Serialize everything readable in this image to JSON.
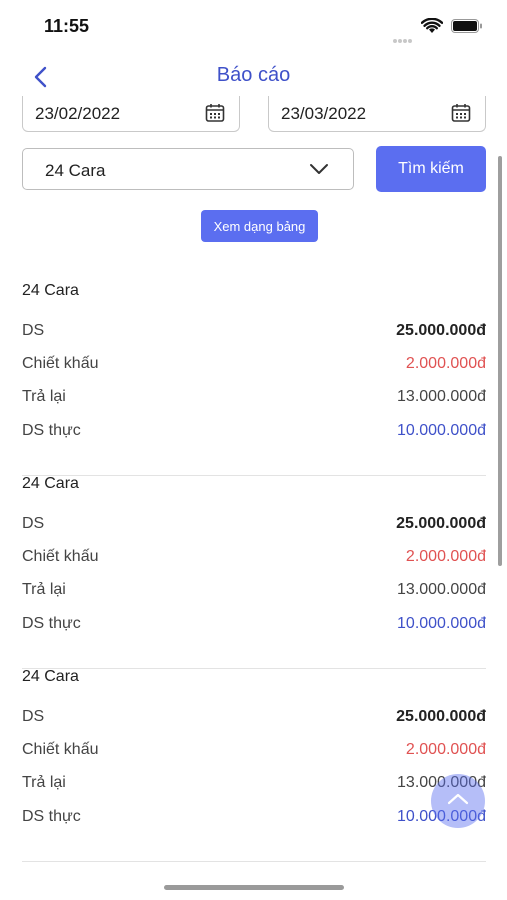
{
  "status_bar": {
    "time": "11:55"
  },
  "header": {
    "title": "Báo cáo"
  },
  "filters": {
    "date_from": "23/02/2022",
    "date_to": "23/03/2022",
    "selected_store": "24 Cara",
    "search_label": "Tìm kiếm",
    "table_view_label": "Xem dạng bảng"
  },
  "reports": [
    {
      "name": "24 Cara",
      "rows": [
        {
          "label": "DS",
          "value": "25.000.000đ"
        },
        {
          "label": "Chiết khấu",
          "value": "2.000.000đ"
        },
        {
          "label": "Trả lại",
          "value": "13.000.000đ"
        },
        {
          "label": "DS thực",
          "value": "10.000.000đ"
        }
      ]
    },
    {
      "name": "24 Cara",
      "rows": [
        {
          "label": "DS",
          "value": "25.000.000đ"
        },
        {
          "label": "Chiết khấu",
          "value": "2.000.000đ"
        },
        {
          "label": "Trả lại",
          "value": "13.000.000đ"
        },
        {
          "label": "DS thực",
          "value": "10.000.000đ"
        }
      ]
    },
    {
      "name": "24 Cara",
      "rows": [
        {
          "label": "DS",
          "value": "25.000.000đ"
        },
        {
          "label": "Chiết khấu",
          "value": "2.000.000đ"
        },
        {
          "label": "Trả lại",
          "value": "13.000.000đ"
        },
        {
          "label": "DS thực",
          "value": "10.000.000đ"
        }
      ]
    }
  ],
  "colors": {
    "accent": "#5b6ef0",
    "title": "#3f51c9",
    "discount": "#e05252",
    "net": "#3f51c9"
  },
  "icons": {
    "back": "chevron-left-icon",
    "calendar": "calendar-icon",
    "dropdown": "chevron-down-icon",
    "scroll_top": "chevron-up-icon"
  }
}
